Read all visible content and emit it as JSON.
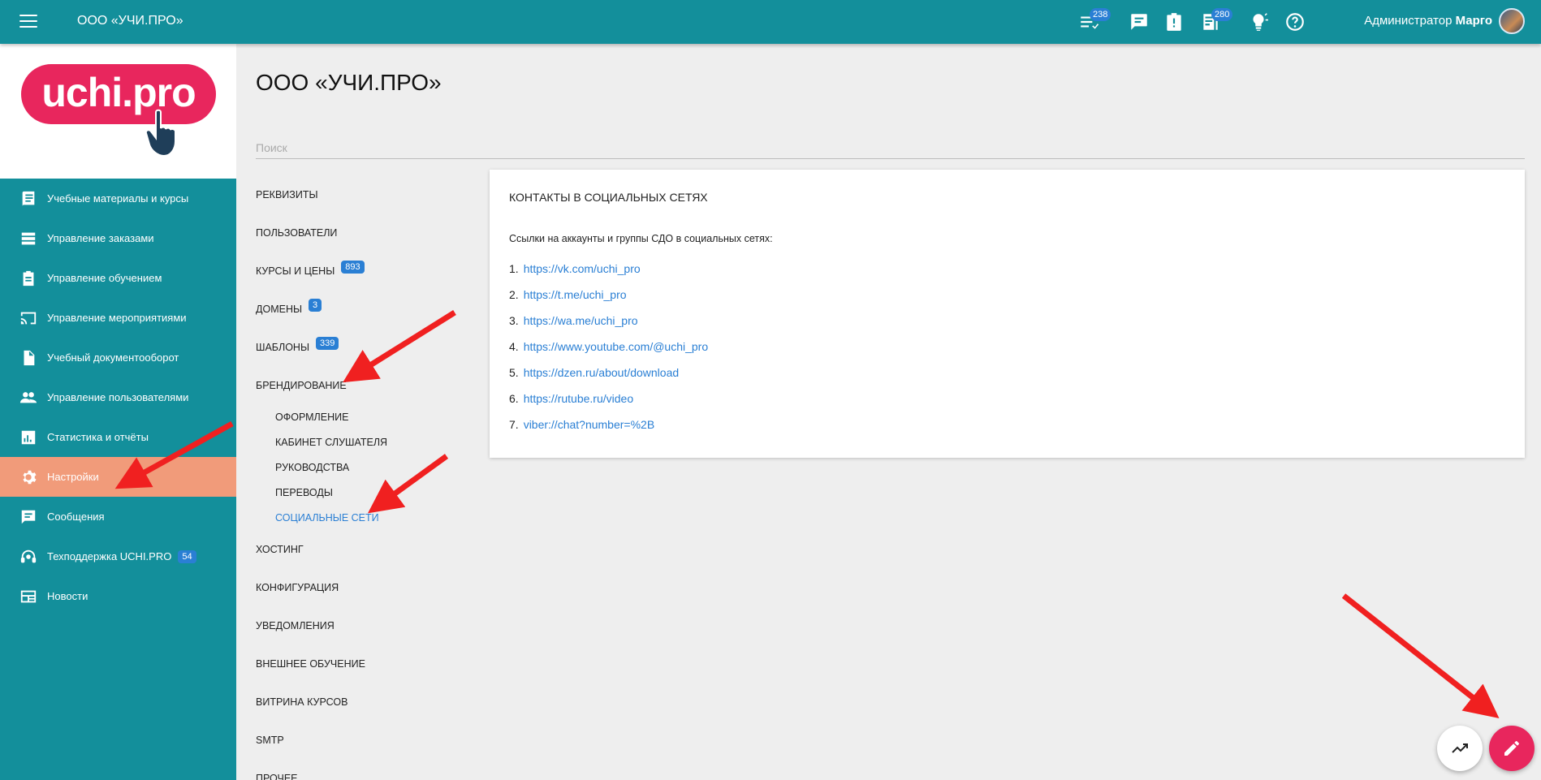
{
  "topbar": {
    "org_name": "ООО «УЧИ.ПРО»",
    "badge_tasks": "238",
    "badge_docs": "280",
    "user_role": "Администратор",
    "user_name": "Марго",
    "icons": [
      "list-icon",
      "chat-icon",
      "clipboard-alert-icon",
      "document-icon",
      "lightbulb-icon",
      "help-icon"
    ]
  },
  "logo": {
    "text": "uchi.pro"
  },
  "sidebar": {
    "items": [
      {
        "label": "Учебные материалы и курсы",
        "icon": "book-icon"
      },
      {
        "label": "Управление заказами",
        "icon": "table-icon"
      },
      {
        "label": "Управление обучением",
        "icon": "clipboard-icon"
      },
      {
        "label": "Управление мероприятиями",
        "icon": "cast-icon"
      },
      {
        "label": "Учебный документооборот",
        "icon": "file-icon"
      },
      {
        "label": "Управление пользователями",
        "icon": "users-icon"
      },
      {
        "label": "Статистика и отчёты",
        "icon": "stats-icon"
      },
      {
        "label": "Настройки",
        "icon": "gear-icon",
        "active": true
      },
      {
        "label": "Сообщения",
        "icon": "message-icon"
      },
      {
        "label": "Техподдержка UCHI.PRO",
        "icon": "support-icon",
        "badge": "54"
      },
      {
        "label": "Новости",
        "icon": "news-icon"
      }
    ]
  },
  "main": {
    "title": "ООО «УЧИ.ПРО»",
    "search_placeholder": "Поиск"
  },
  "subnav": {
    "items": [
      {
        "label": "Реквизиты"
      },
      {
        "label": "Пользователи"
      },
      {
        "label": "Курсы и цены",
        "badge": "893"
      },
      {
        "label": "Домены",
        "badge": "3"
      },
      {
        "label": "Шаблоны",
        "badge": "339"
      },
      {
        "label": "Брендирование"
      }
    ],
    "children": [
      {
        "label": "Оформление"
      },
      {
        "label": "Кабинет слушателя"
      },
      {
        "label": "Руководства"
      },
      {
        "label": "Переводы"
      },
      {
        "label": "Социальные сети",
        "active": true
      }
    ],
    "items_after": [
      {
        "label": "Хостинг"
      },
      {
        "label": "Конфигурация"
      },
      {
        "label": "Уведомления"
      },
      {
        "label": "Внешнее обучение"
      },
      {
        "label": "Витрина курсов"
      },
      {
        "label": "SMTP"
      },
      {
        "label": "Прочее"
      }
    ]
  },
  "card": {
    "title": "Контакты в социальных сетях",
    "description": "Ссылки на аккаунты и группы СДО в социальных сетях:",
    "links": [
      {
        "num": "1.",
        "url": "https://vk.com/uchi_pro"
      },
      {
        "num": "2.",
        "url": "https://t.me/uchi_pro"
      },
      {
        "num": "3.",
        "url": "https://wa.me/uchi_pro"
      },
      {
        "num": "4.",
        "url": "https://www.youtube.com/@uchi_pro"
      },
      {
        "num": "5.",
        "url": "https://dzen.ru/about/download"
      },
      {
        "num": "6.",
        "url": "https://rutube.ru/video"
      },
      {
        "num": "7.",
        "url": "viber://chat?number=%2B"
      }
    ]
  },
  "fabs": {
    "chart_icon": "trending-icon",
    "edit_icon": "pencil-icon"
  },
  "annotation": {
    "arrow_color": "#f02020"
  }
}
